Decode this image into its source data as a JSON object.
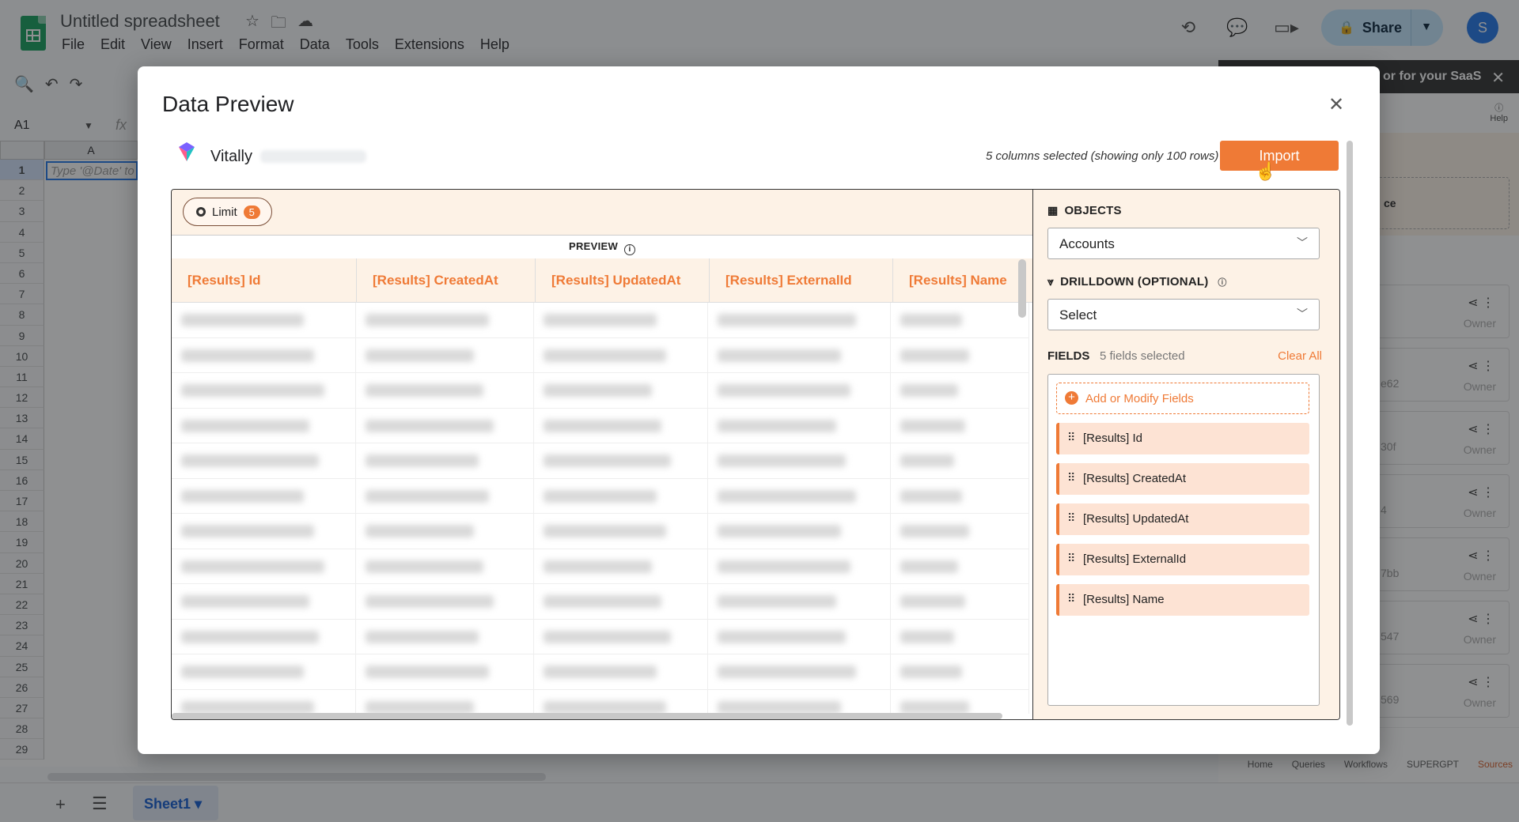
{
  "sheets": {
    "doc_title": "Untitled spreadsheet",
    "menu": [
      "File",
      "Edit",
      "View",
      "Insert",
      "Format",
      "Data",
      "Tools",
      "Extensions",
      "Help"
    ],
    "share_label": "Share",
    "avatar_letter": "S",
    "name_box": "A1",
    "fx_label": "fx",
    "column_a": "A",
    "cell_a1_placeholder": "Type '@Date' to",
    "rows": [
      "1",
      "2",
      "3",
      "4",
      "5",
      "6",
      "7",
      "8",
      "9",
      "10",
      "11",
      "12",
      "13",
      "14",
      "15",
      "16",
      "17",
      "18",
      "19",
      "20",
      "21",
      "22",
      "23",
      "24",
      "25",
      "26",
      "27",
      "28",
      "29"
    ],
    "sheet_tab": "Sheet1"
  },
  "addon": {
    "header_fragment": "or for your SaaS",
    "help_label": "Help",
    "dashed_fragment": "ce",
    "owner_label": "Owner",
    "card_fragments": [
      "",
      "",
      "e62",
      "30f",
      "4",
      "7bb",
      "547",
      "569"
    ],
    "nav": [
      "Home",
      "Queries",
      "Workflows",
      "SUPERGPT",
      "Sources"
    ]
  },
  "modal": {
    "title": "Data Preview",
    "source_name": "Vitally",
    "columns_summary": "5 columns selected (showing only 100 rows)",
    "import_label": "Import",
    "limit_label": "Limit",
    "limit_value": "5",
    "preview_label": "PREVIEW",
    "table_headers": [
      "[Results] Id",
      "[Results] CreatedAt",
      "[Results] UpdatedAt",
      "[Results] ExternalId",
      "[Results] Name"
    ],
    "row_count_visible": 12,
    "objects_title": "OBJECTS",
    "objects_value": "Accounts",
    "drilldown_title": "DRILLDOWN (OPTIONAL)",
    "drilldown_value": "Select",
    "fields_title": "FIELDS",
    "fields_count": "5 fields selected",
    "clear_all": "Clear All",
    "add_fields": "Add or Modify Fields",
    "fields": [
      "[Results] Id",
      "[Results] CreatedAt",
      "[Results] UpdatedAt",
      "[Results] ExternalId",
      "[Results] Name"
    ]
  },
  "colors": {
    "accent": "#ef7a36",
    "panel_bg": "#fdf2e6",
    "field_bg": "#fde3d4",
    "sheets_green": "#0f9d58",
    "share_bg": "#c2e7ff"
  }
}
